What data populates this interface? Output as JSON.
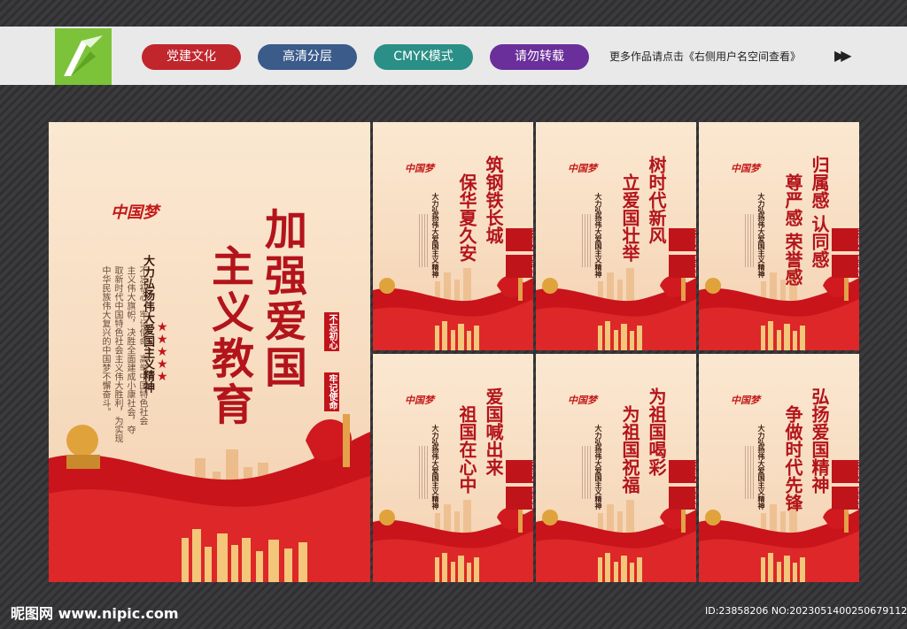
{
  "header": {
    "tags": [
      {
        "label": "党建文化",
        "color": "#c0262c"
      },
      {
        "label": "高清分层",
        "color": "#3b5b8a"
      },
      {
        "label": "CMYK模式",
        "color": "#2a8f86"
      },
      {
        "label": "请勿转载",
        "color": "#6a2f9a"
      }
    ],
    "tagline": "更多作品请点击《右侧用户名空间查看》"
  },
  "main_poster": {
    "title_col1": "加强爱国",
    "title_col2": "主义教育",
    "subtitle": "大力弘扬伟大爱国主义精神",
    "body_lines": [
      "不忘初心，牢记使命，高举中国特色社会",
      "主义伟大旗帜，决胜全面建成小康社会，夺",
      "取新时代中国特色社会主义伟大胜利，为实现",
      "中华民族伟大复兴的中国梦不懈奋斗。"
    ],
    "seal_a": "不忘初心",
    "seal_b": "牢记使命",
    "brand": "中国梦"
  },
  "small_posters": [
    {
      "col1": "筑钢铁长城",
      "col2": "保华夏久安"
    },
    {
      "col1": "树时代新风",
      "col2": "立爱国壮举"
    },
    {
      "col1": "归属感 认同感",
      "col2": "尊严感 荣誉感"
    },
    {
      "col1": "爱国喊出来",
      "col2": "祖国在心中"
    },
    {
      "col1": "为祖国喝彩",
      "col2": "为祖国祝福"
    },
    {
      "col1": "弘扬爱国精神",
      "col2": "争做时代先锋"
    }
  ],
  "small_common": {
    "subtitle": "大力弘扬伟大爱国主义精神",
    "seal_a": "不忘初心",
    "seal_b": "牢记使命",
    "brand": "中国梦"
  },
  "footer": {
    "site": "昵图网 www.nipic.com",
    "id": "ID:23858206 NO:20230514002506791121"
  }
}
